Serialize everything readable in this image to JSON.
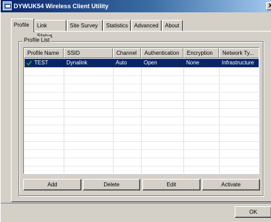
{
  "window": {
    "title": "DYWUK54 Wireless Client Utility",
    "close_glyph": "X"
  },
  "tabs": [
    {
      "label": "Profile",
      "active": true
    },
    {
      "label": "Link Status",
      "active": false
    },
    {
      "label": "Site Survey",
      "active": false
    },
    {
      "label": "Statistics",
      "active": false
    },
    {
      "label": "Advanced",
      "active": false
    },
    {
      "label": "About",
      "active": false
    }
  ],
  "profile_list": {
    "group_label": "Profile List",
    "columns": [
      "Profile Name",
      "SSID",
      "Channel",
      "Authentication",
      "Encryption",
      "Network Ty..."
    ],
    "rows": [
      {
        "profile_name": "TEST",
        "ssid": "Dynalink",
        "channel": "Auto",
        "authentication": "Open",
        "encryption": "None",
        "network_type": "Infrastructure",
        "selected": true,
        "active_icon": "green-check-icon"
      }
    ]
  },
  "buttons": {
    "add": "Add",
    "delete": "Delete",
    "edit": "Edit",
    "activate": "Activate",
    "ok": "OK"
  },
  "colors": {
    "selection": "#0a246a",
    "check": "#2e9a2e",
    "face": "#d4d0c8"
  }
}
